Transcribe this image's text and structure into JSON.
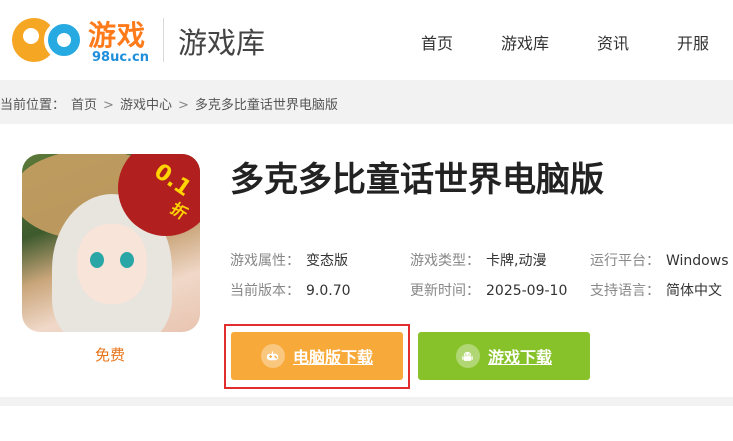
{
  "header": {
    "logo_brand": "游戏",
    "logo_domain": "98uc.cn",
    "section_title": "游戏库",
    "nav": [
      "首页",
      "游戏库",
      "资讯",
      "开服"
    ]
  },
  "breadcrumb": {
    "prefix": "当前位置：",
    "items": [
      "首页",
      "游戏中心",
      "多克多比童话世界电脑版"
    ],
    "separator": ">"
  },
  "game": {
    "title": "多克多比童话世界电脑版",
    "cover_badge": "0.1",
    "cover_badge_unit": "折",
    "price": "免费",
    "attrs": [
      {
        "key": "游戏属性：",
        "value": "变态版"
      },
      {
        "key": "游戏类型：",
        "value": "卡牌,动漫"
      },
      {
        "key": "运行平台：",
        "value": "Windows"
      },
      {
        "key": "当前版本：",
        "value": "9.0.70"
      },
      {
        "key": "更新时间：",
        "value": "2025-09-10"
      },
      {
        "key": "支持语言：",
        "value": "简体中文"
      }
    ],
    "buttons": {
      "pc": "电脑版下载",
      "game": "游戏下载"
    }
  },
  "colors": {
    "pc_button": "#f7a93a",
    "game_button": "#87c22a",
    "highlight_border": "#e02d2d",
    "price": "#e8741a"
  }
}
